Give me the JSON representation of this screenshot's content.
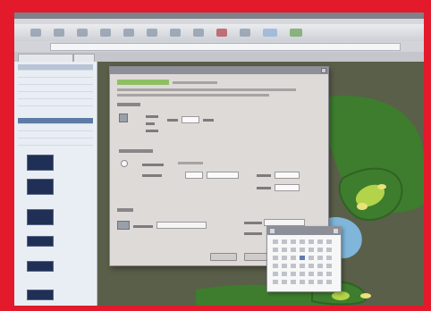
{
  "app": {
    "window_title": "",
    "address_text": "",
    "frame_color": "#e21a2b",
    "accent_color": "#5e7aa6"
  },
  "toolbar": {
    "tools": [
      {
        "icon": "toolbar-tool-icon"
      },
      {
        "icon": "toolbar-tool-icon"
      },
      {
        "icon": "toolbar-tool-icon"
      },
      {
        "icon": "toolbar-tool-icon"
      },
      {
        "icon": "toolbar-tool-icon"
      },
      {
        "icon": "toolbar-tool-icon"
      },
      {
        "icon": "toolbar-tool-icon"
      },
      {
        "icon": "toolbar-tool-icon"
      },
      {
        "icon": "toolbar-tool-icon"
      },
      {
        "icon": "toolbar-tool-icon"
      },
      {
        "icon": "toolbar-tool-icon"
      },
      {
        "icon": "toolbar-tool-icon"
      }
    ]
  },
  "sidebar": {
    "items": [
      {
        "label": ""
      },
      {
        "label": ""
      },
      {
        "label": ""
      },
      {
        "label": ""
      },
      {
        "label": ""
      },
      {
        "label": ""
      }
    ]
  },
  "map": {
    "colors": {
      "rough": "#5a5f49",
      "fairway": "#3e7d2e",
      "green": "#b3d34a",
      "water": "#7fb6d9",
      "sand": "#e8e27a"
    }
  },
  "dialog": {
    "title": "",
    "heading": "",
    "description": "",
    "ok_label": "",
    "cancel_label": ""
  },
  "datepicker": {
    "month_label": ""
  }
}
